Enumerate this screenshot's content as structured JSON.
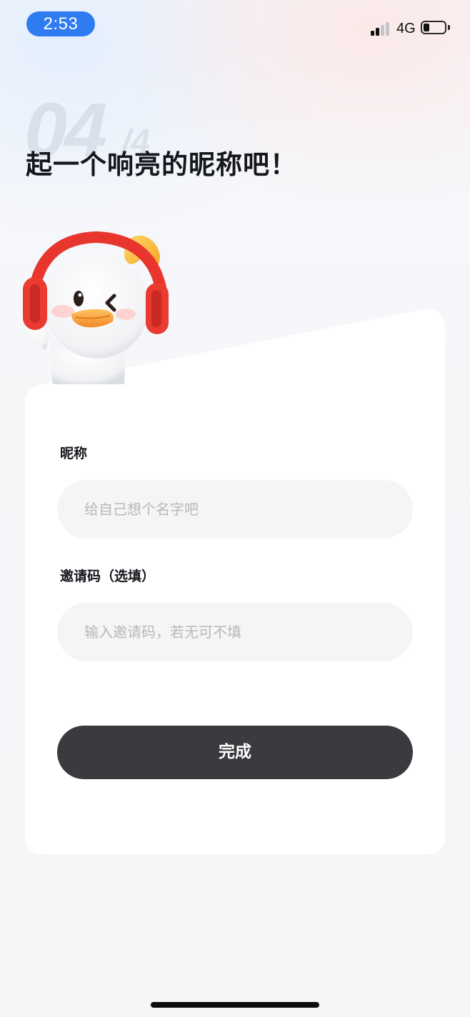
{
  "status_bar": {
    "time": "2:53",
    "network": "4G",
    "signal_bars_active": 2,
    "signal_bars_total": 4,
    "battery_level": 0.3
  },
  "header": {
    "step_current": "04",
    "step_total": "/4",
    "title": "起一个响亮的昵称吧！"
  },
  "form": {
    "nickname": {
      "label": "昵称",
      "value": "",
      "placeholder": "给自己想个名字吧"
    },
    "invite_code": {
      "label": "邀请码（选填）",
      "value": "",
      "placeholder": "输入邀请码，若无可不填"
    },
    "submit_label": "完成"
  },
  "icons": {
    "mascot": "duck-mascot-with-headphones-icon",
    "signal": "cellular-signal-icon",
    "battery": "battery-icon"
  },
  "colors": {
    "time_pill": "#2f7bf2",
    "primary_button": "#3a3b3f",
    "input_background": "#f5f5f5",
    "headphones": "#ea3a32",
    "duck_beak": "#f6a43a"
  }
}
